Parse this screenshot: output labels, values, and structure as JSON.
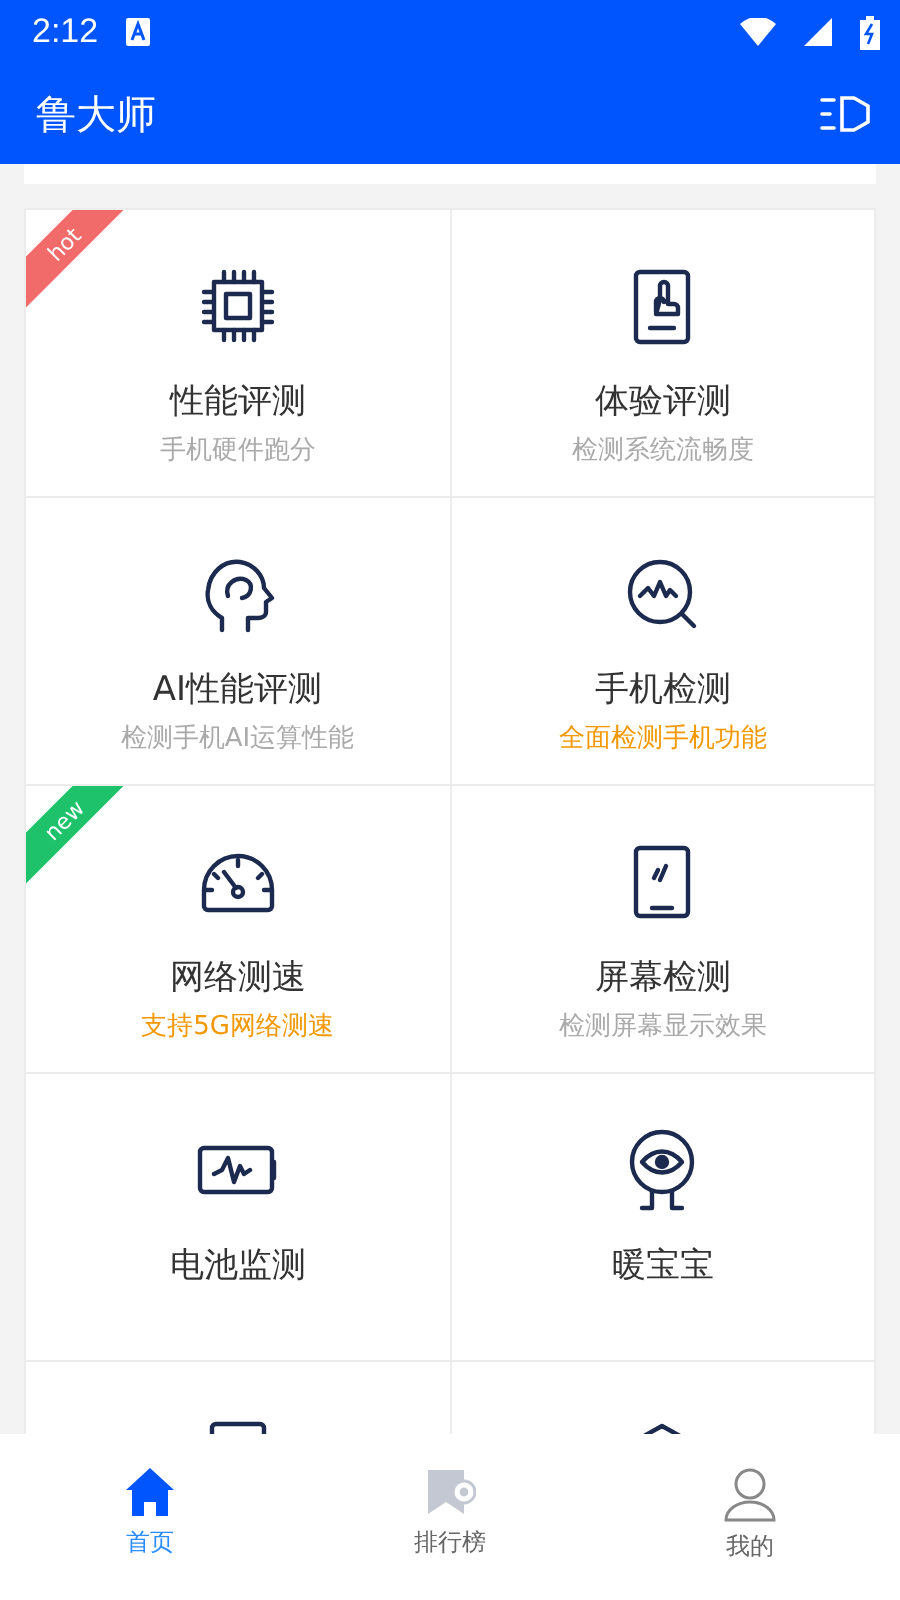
{
  "status_bar": {
    "time": "2:12"
  },
  "app_bar": {
    "title": "鲁大师"
  },
  "features": [
    {
      "kind": "full",
      "title": "性能评测",
      "subtitle": "手机硬件跑分",
      "highlighted": false,
      "badge": {
        "text": "hot",
        "color": "#f26b6b"
      }
    },
    {
      "kind": "full",
      "title": "体验评测",
      "subtitle": "检测系统流畅度",
      "highlighted": false
    },
    {
      "kind": "full",
      "title": "AI性能评测",
      "subtitle": "检测手机AI运算性能",
      "highlighted": false
    },
    {
      "kind": "full",
      "title": "手机检测",
      "subtitle": "全面检测手机功能",
      "highlighted": true
    },
    {
      "kind": "full",
      "title": "网络测速",
      "subtitle": "支持5G网络测速",
      "highlighted": true,
      "badge": {
        "text": "new",
        "color": "#1ec26a"
      }
    },
    {
      "kind": "full",
      "title": "屏幕检测",
      "subtitle": "检测屏幕显示效果",
      "highlighted": false
    },
    {
      "kind": "full",
      "title": "电池监测"
    },
    {
      "kind": "full",
      "title": "暖宝宝"
    },
    {
      "kind": "cut_off"
    },
    {
      "kind": "cut_off"
    }
  ],
  "tabs": [
    {
      "label": "首页",
      "selected": true
    },
    {
      "label": "排行榜",
      "selected": false
    },
    {
      "label": "我的",
      "selected": false
    }
  ]
}
